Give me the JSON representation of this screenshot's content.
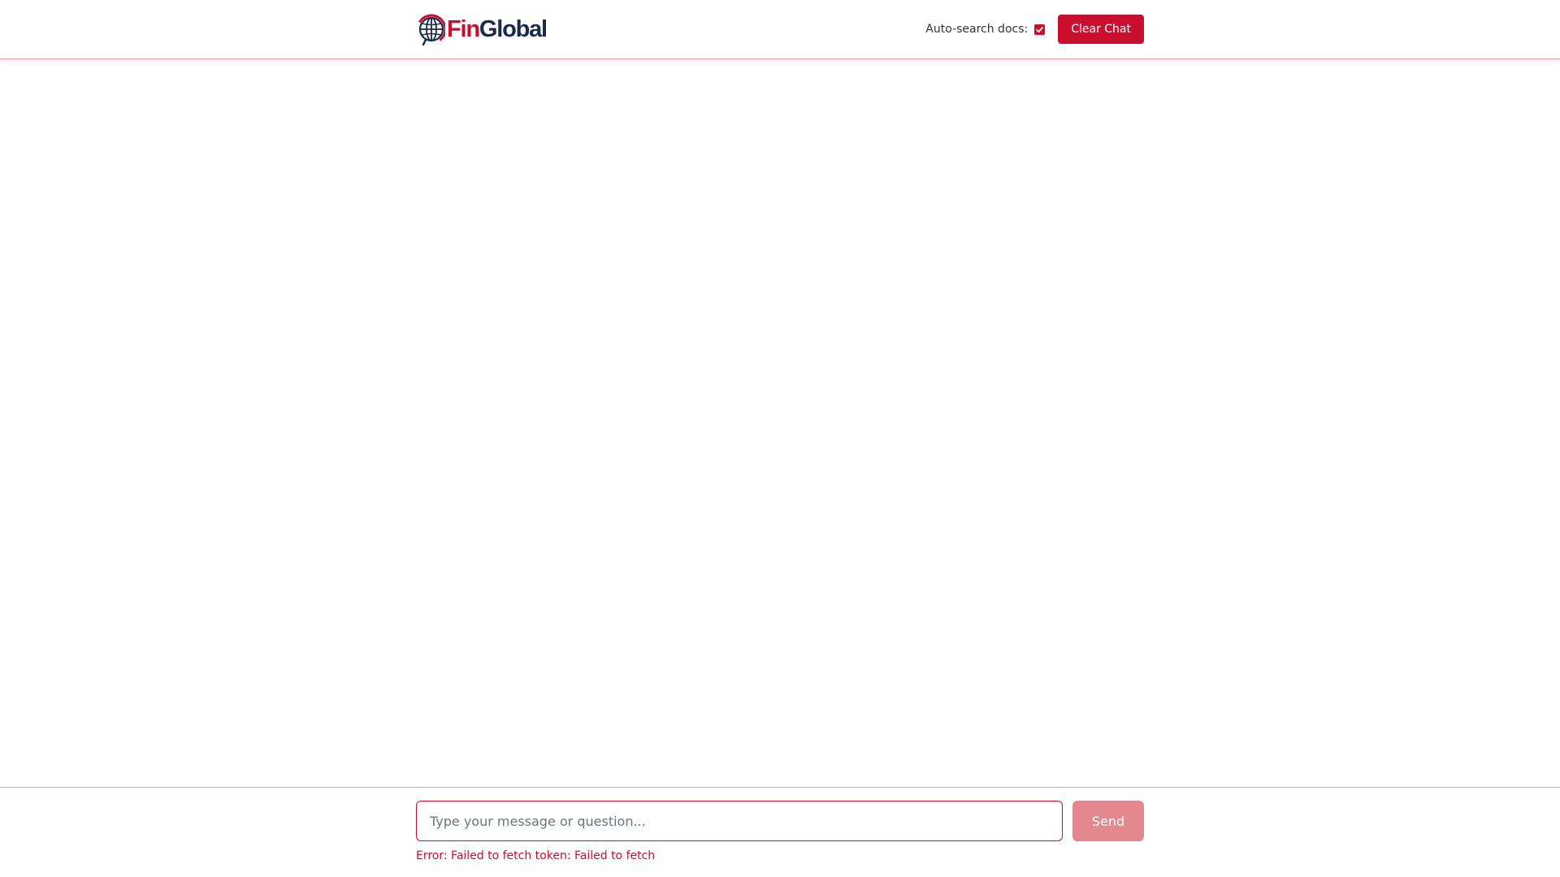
{
  "header": {
    "logo": {
      "fin": "Fin",
      "global": "Global"
    },
    "auto_search_label": "Auto-search docs:",
    "auto_search_checked": true,
    "clear_chat_label": "Clear Chat"
  },
  "composer": {
    "placeholder": "Type your message or question...",
    "value": "",
    "send_label": "Send",
    "error": "Error: Failed to fetch token: Failed to fetch"
  },
  "colors": {
    "brand_red": "#c8102e",
    "brand_navy": "#1b2a4a",
    "send_disabled": "#e3888f"
  }
}
